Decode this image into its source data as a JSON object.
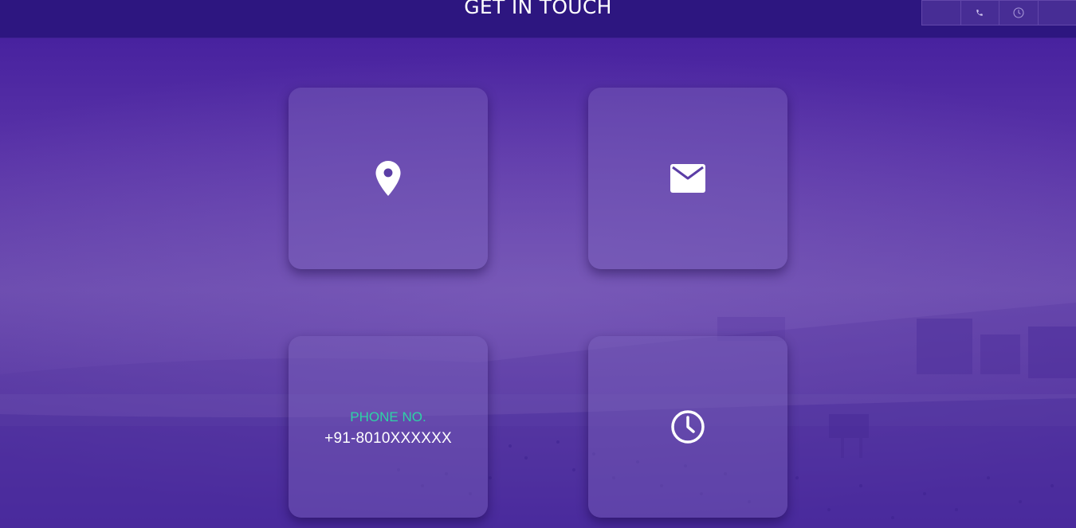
{
  "header": {
    "title": "GET IN TOUCH"
  },
  "cards": {
    "location": {
      "icon": "map-pin-icon"
    },
    "email": {
      "icon": "envelope-icon"
    },
    "phone": {
      "label": "PHONE NO.",
      "value": "+91-8010XXXXXX"
    },
    "hours": {
      "icon": "clock-icon"
    }
  },
  "colors": {
    "header_bg": "#2d1680",
    "page_bg": "#5a34a8",
    "accent_label": "#2ed3a6",
    "text": "#ffffff"
  }
}
